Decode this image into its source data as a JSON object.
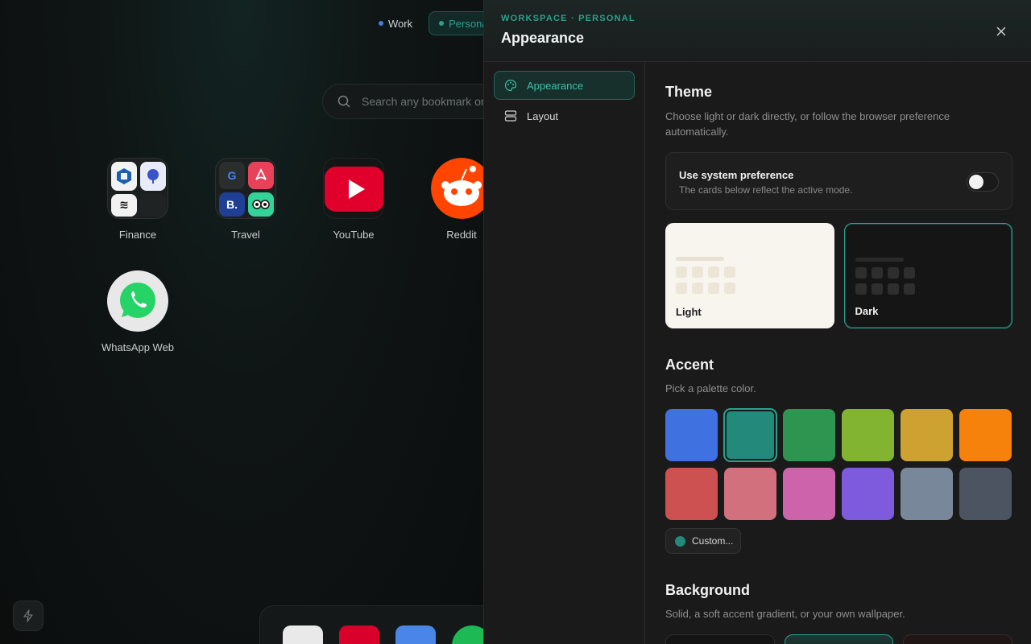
{
  "background_page": {
    "workspaces": [
      {
        "label": "Work",
        "color": "#4a7ae6",
        "active": false
      },
      {
        "label": "Personal",
        "color": "#2aa18e",
        "active": true
      }
    ],
    "search": {
      "placeholder": "Search any bookmark or"
    },
    "tiles": [
      {
        "label": "Finance",
        "kind": "folder"
      },
      {
        "label": "Travel",
        "kind": "folder"
      },
      {
        "label": "YouTube",
        "icon": "youtube-icon"
      },
      {
        "label": "Reddit",
        "icon": "reddit-icon"
      },
      {
        "label": "WhatsApp Web",
        "icon": "whatsapp-icon"
      }
    ],
    "travel_tiles": {
      "google": "G",
      "booking": "B."
    },
    "dock_icons": [
      "gmail-icon",
      "youtube-icon",
      "calendar-icon",
      "spotify-icon"
    ]
  },
  "panel": {
    "eyebrow": "WORKSPACE · PERSONAL",
    "title": "Appearance",
    "nav": [
      {
        "label": "Appearance",
        "icon": "palette-icon",
        "active": true
      },
      {
        "label": "Layout",
        "icon": "layout-icon",
        "active": false
      }
    ],
    "theme": {
      "title": "Theme",
      "desc": "Choose light or dark directly, or follow the browser preference automatically.",
      "system_pref": {
        "title": "Use system preference",
        "sub": "The cards below reflect the active mode.",
        "enabled": false
      },
      "options": [
        {
          "label": "Light",
          "selected": false
        },
        {
          "label": "Dark",
          "selected": true
        }
      ]
    },
    "accent": {
      "title": "Accent",
      "desc": "Pick a palette color.",
      "colors": [
        "#3f72e0",
        "#23897b",
        "#2e9550",
        "#82b432",
        "#cea230",
        "#f6820c",
        "#cc5150",
        "#d2717d",
        "#cc63ab",
        "#7e5adc",
        "#79879a",
        "#4c5462"
      ],
      "selected_index": 1,
      "custom_label": "Custom...",
      "custom_color": "#23897b"
    },
    "background": {
      "title": "Background",
      "desc": "Solid, a soft accent gradient, or your own wallpaper."
    }
  }
}
